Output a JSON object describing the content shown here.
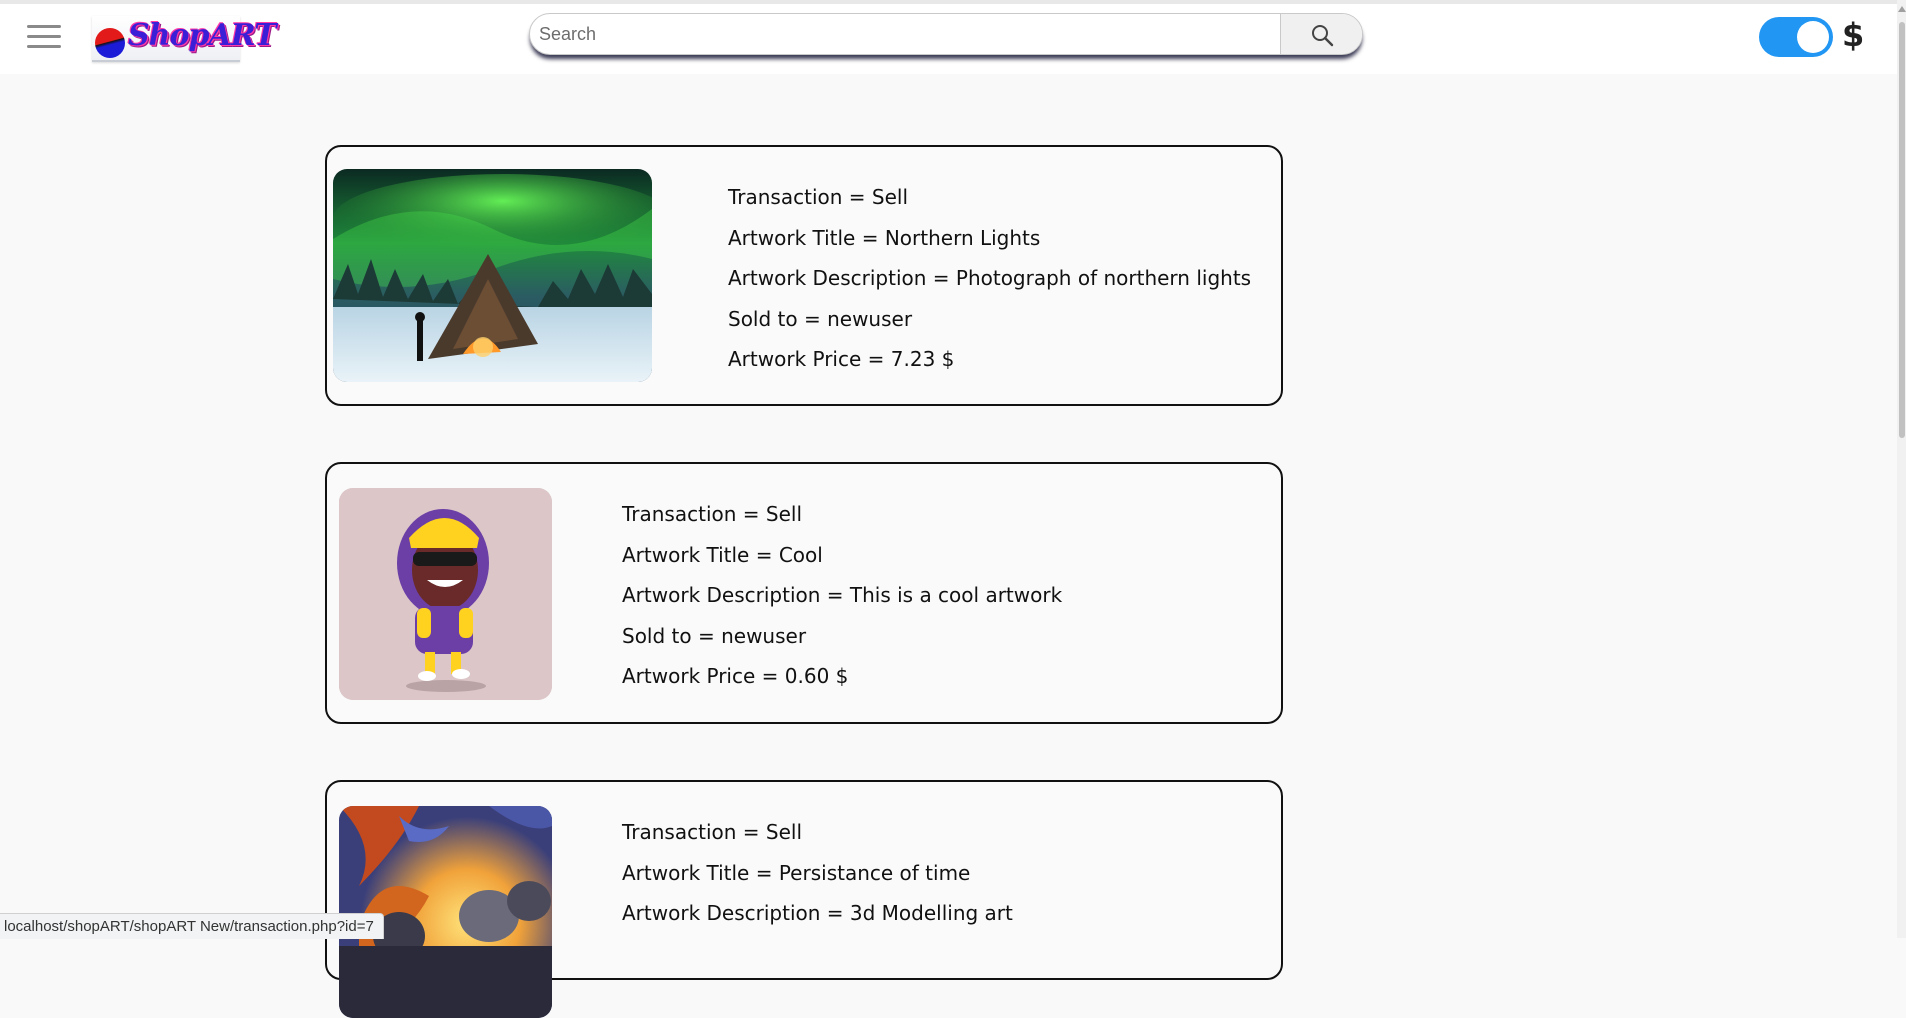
{
  "header": {
    "logo_text": "ShopART",
    "search": {
      "placeholder": "Search",
      "value": ""
    },
    "currency_symbol": "$",
    "currency_toggle_on": true
  },
  "transactions": [
    {
      "transaction_text": "Transaction = Sell",
      "title_text": "Artwork Title = Northern Lights",
      "description_text": "Artwork Description = Photograph of northern lights",
      "sold_to_text": "Sold to = newuser",
      "price_text": "Artwork Price = 7.23 $"
    },
    {
      "transaction_text": "Transaction = Sell",
      "title_text": "Artwork Title = Cool",
      "description_text": "Artwork Description = This is a cool artwork",
      "sold_to_text": "Sold to = newuser",
      "price_text": "Artwork Price = 0.60 $"
    },
    {
      "transaction_text": "Transaction = Sell",
      "title_text": "Artwork Title = Persistance of time",
      "description_text": "Artwork Description = 3d Modelling art",
      "sold_to_text": "",
      "price_text": ""
    }
  ],
  "status_bar": {
    "url": "localhost/shopART/shopART New/transaction.php?id=7"
  },
  "colors": {
    "toggle": "#2196f3",
    "card_border": "#111111",
    "page_background": "#f9f9f9"
  }
}
